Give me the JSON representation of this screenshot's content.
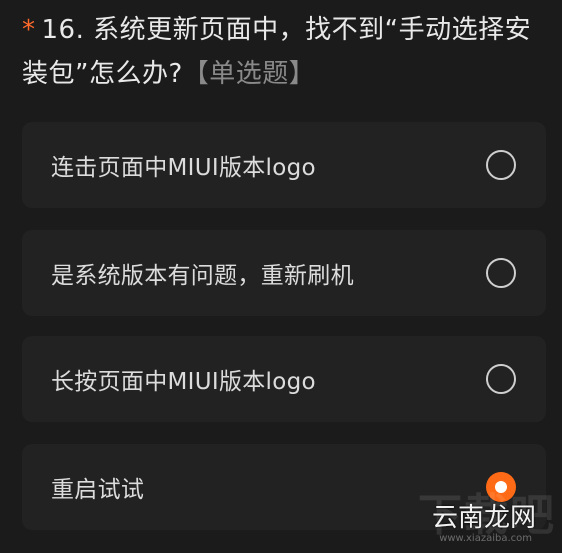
{
  "question": {
    "required_mark": "*",
    "text": "16. 系统更新页面中，找不到“手动选择安装包”怎么办?",
    "type_label": "【单选题】"
  },
  "options": [
    {
      "label": "连击页面中MIUI版本logo",
      "selected": false
    },
    {
      "label": "是系统版本有问题，重新刷机",
      "selected": false
    },
    {
      "label": "长按页面中MIUI版本logo",
      "selected": false
    },
    {
      "label": "重启试试",
      "selected": true
    }
  ],
  "watermark": {
    "big": "下载吧",
    "site": "云南龙网",
    "url": "www.xiazaiba.com"
  },
  "colors": {
    "background": "#1b1b1b",
    "accent": "#ff6a16",
    "required_mark": "#ff6a2b"
  }
}
